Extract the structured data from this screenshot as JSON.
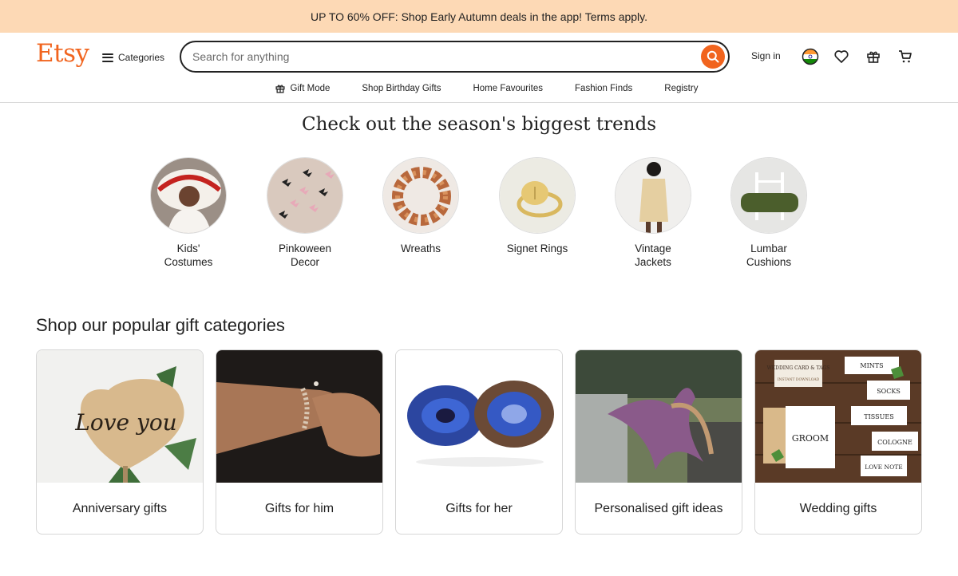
{
  "promo": {
    "text": "UP TO 60% OFF: Shop Early Autumn deals in the app! Terms apply."
  },
  "header": {
    "logo": "Etsy",
    "categories_label": "Categories",
    "search_placeholder": "Search for anything",
    "signin_label": "Sign in",
    "icons": [
      "search-icon",
      "india-flag-icon",
      "heart-icon",
      "gift-icon",
      "cart-icon"
    ]
  },
  "subnav": [
    "Gift Mode",
    "Shop Birthday Gifts",
    "Home Favourites",
    "Fashion Finds",
    "Registry"
  ],
  "trends": {
    "title": "Check out the season's biggest trends",
    "items": [
      {
        "line1": "Kids'",
        "line2": "Costumes"
      },
      {
        "line1": "Pinkoween",
        "line2": "Decor"
      },
      {
        "line1": "Wreaths",
        "line2": ""
      },
      {
        "line1": "Signet Rings",
        "line2": ""
      },
      {
        "line1": "Vintage",
        "line2": "Jackets"
      },
      {
        "line1": "Lumbar",
        "line2": "Cushions"
      }
    ]
  },
  "gifts": {
    "title": "Shop our popular gift categories",
    "items": [
      "Anniversary gifts",
      "Gifts for him",
      "Gifts for her",
      "Personalised gift ideas",
      "Wedding gifts"
    ],
    "image_text": {
      "love": "Love you",
      "wedding_header": "WEDDING CARD & TAGS",
      "wedding_sub": "INSTANT DOWNLOAD",
      "groom": "GROOM",
      "tags": [
        "MINTS",
        "SOCKS",
        "TISSUES",
        "COLOGNE",
        "LOVE NOTE"
      ]
    }
  },
  "colors": {
    "brand": "#f1641e",
    "promo_bg": "#fdd9b5",
    "text": "#222222"
  }
}
